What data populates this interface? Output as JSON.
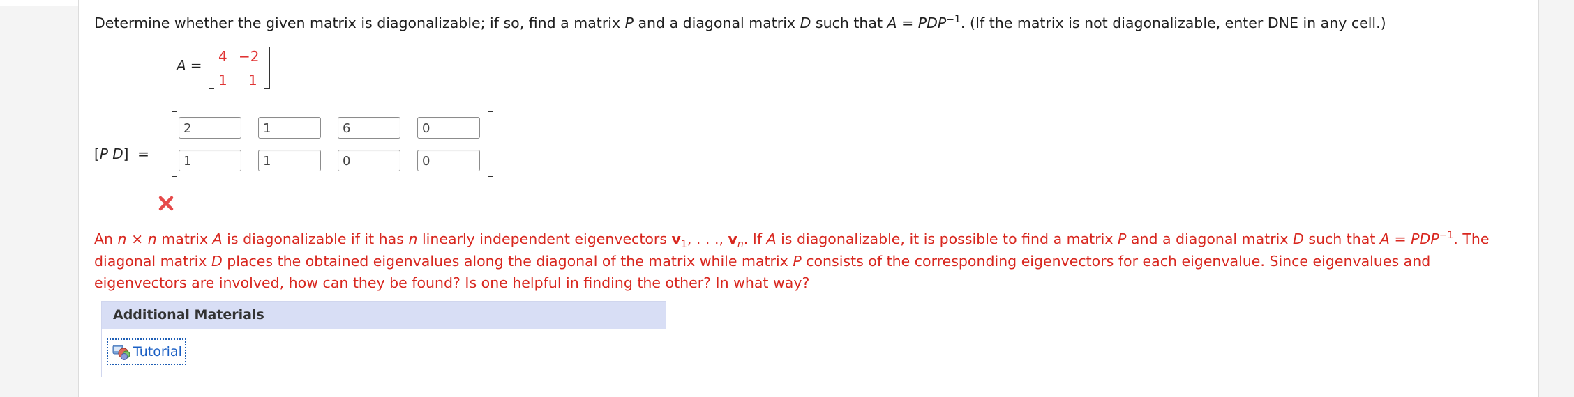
{
  "question": {
    "part1": "Determine whether the given matrix is diagonalizable; if so, find a matrix ",
    "var_p": "P",
    "part2": " and a diagonal matrix ",
    "var_d": "D",
    "part3": " such that ",
    "formula_a": "A",
    "formula_eq": " = ",
    "formula_pdp": "PDP",
    "formula_exp": "−1",
    "part4": ". (If the matrix is not diagonalizable, enter DNE in any cell.)"
  },
  "matrix_a": {
    "label": "A",
    "equals": "=",
    "rows": [
      [
        "4",
        "−2"
      ],
      [
        "1",
        "1"
      ]
    ]
  },
  "pd_matrix": {
    "label_open": "[",
    "label_p": "P",
    "label_d": "D",
    "label_close": "]",
    "equals": "=",
    "rows": [
      [
        "2",
        "1",
        "6",
        "0"
      ],
      [
        "1",
        "1",
        "0",
        "0"
      ]
    ]
  },
  "feedback": {
    "t1": "An ",
    "n1": "n",
    "times": " × ",
    "n2": "n",
    "t2": " matrix ",
    "a1": "A",
    "t3": " is diagonalizable if it has ",
    "n3": "n",
    "t4": " linearly independent eigenvectors ",
    "v1": "v",
    "v1sub": "1",
    "dots": ", . . ., ",
    "vn": "v",
    "vnsub": "n",
    "t5": ". If ",
    "a2": "A",
    "t6": " is diagonalizable, it is possible to find a matrix ",
    "p1": "P",
    "t7": " and a diagonal matrix ",
    "d1": "D",
    "t8": " such that ",
    "a3": "A",
    "eq": " = ",
    "pdp": "PDP",
    "exp": "−1",
    "t9": ". The diagonal matrix ",
    "d2": "D",
    "t10": " places the obtained eigenvalues along the diagonal of the matrix while matrix ",
    "p2": "P",
    "t11": " consists of the corresponding eigenvectors for each eigenvalue. Since eigenvalues and eigenvectors are involved, how can they be found? Is one helpful in finding the other? In what way?"
  },
  "materials": {
    "heading": "Additional Materials",
    "tutorial_label": "Tutorial"
  },
  "colors": {
    "feedback": "#d8271f",
    "matrix_values": "#e03333",
    "link": "#1a5fc4",
    "materials_header": "#d8def5"
  },
  "icons": {
    "status": "wrong-x-icon",
    "tutorial": "tutorial-icon"
  }
}
